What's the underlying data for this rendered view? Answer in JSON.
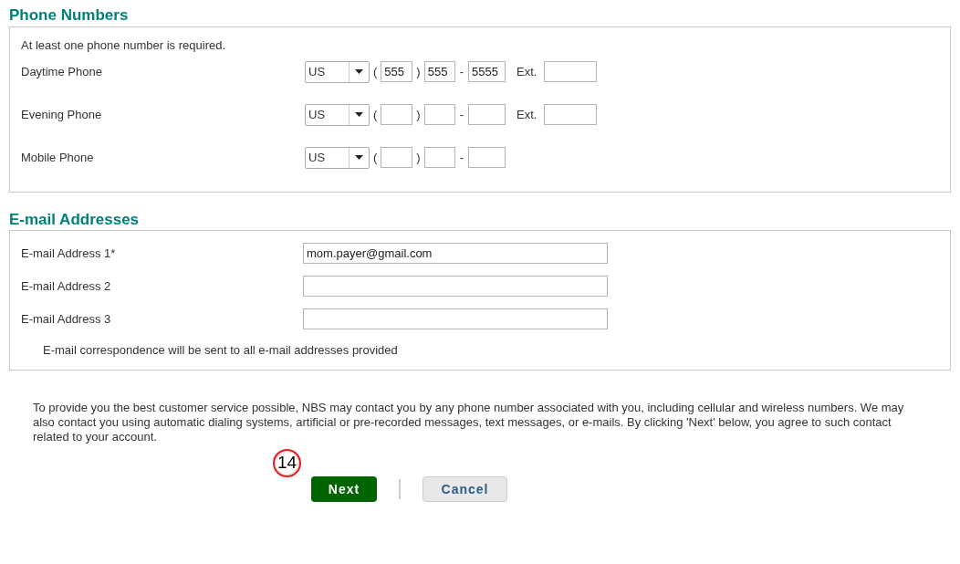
{
  "phone_section": {
    "title": "Phone Numbers",
    "note": "At least one phone number is required.",
    "phones": [
      {
        "label": "Daytime Phone",
        "country": "US",
        "area": "555",
        "prefix": "555",
        "line": "5555",
        "ext_label": "Ext."
      },
      {
        "label": "Evening Phone",
        "country": "US",
        "ext_label": "Ext."
      },
      {
        "label": "Mobile Phone",
        "country": "US"
      }
    ],
    "open_paren": "(",
    "close_paren": ")",
    "dash": "-"
  },
  "email_section": {
    "title": "E-mail Addresses",
    "emails": [
      {
        "label": "E-mail Address 1*",
        "value": "mom.payer@gmail.com"
      },
      {
        "label": "E-mail Address 2"
      },
      {
        "label": "E-mail Address 3"
      }
    ],
    "note": "E-mail correspondence will be sent to all e-mail addresses provided"
  },
  "consent": "To provide you the best customer service possible, NBS may contact you by any phone number associated with you, including cellular and wireless numbers. We may also contact you using automatic dialing systems, artificial or pre-recorded messages, text messages, or e-mails.   By clicking 'Next' below, you agree to such contact related to your account.",
  "step_badge": "14",
  "buttons": {
    "next": "Next",
    "cancel": "Cancel"
  }
}
